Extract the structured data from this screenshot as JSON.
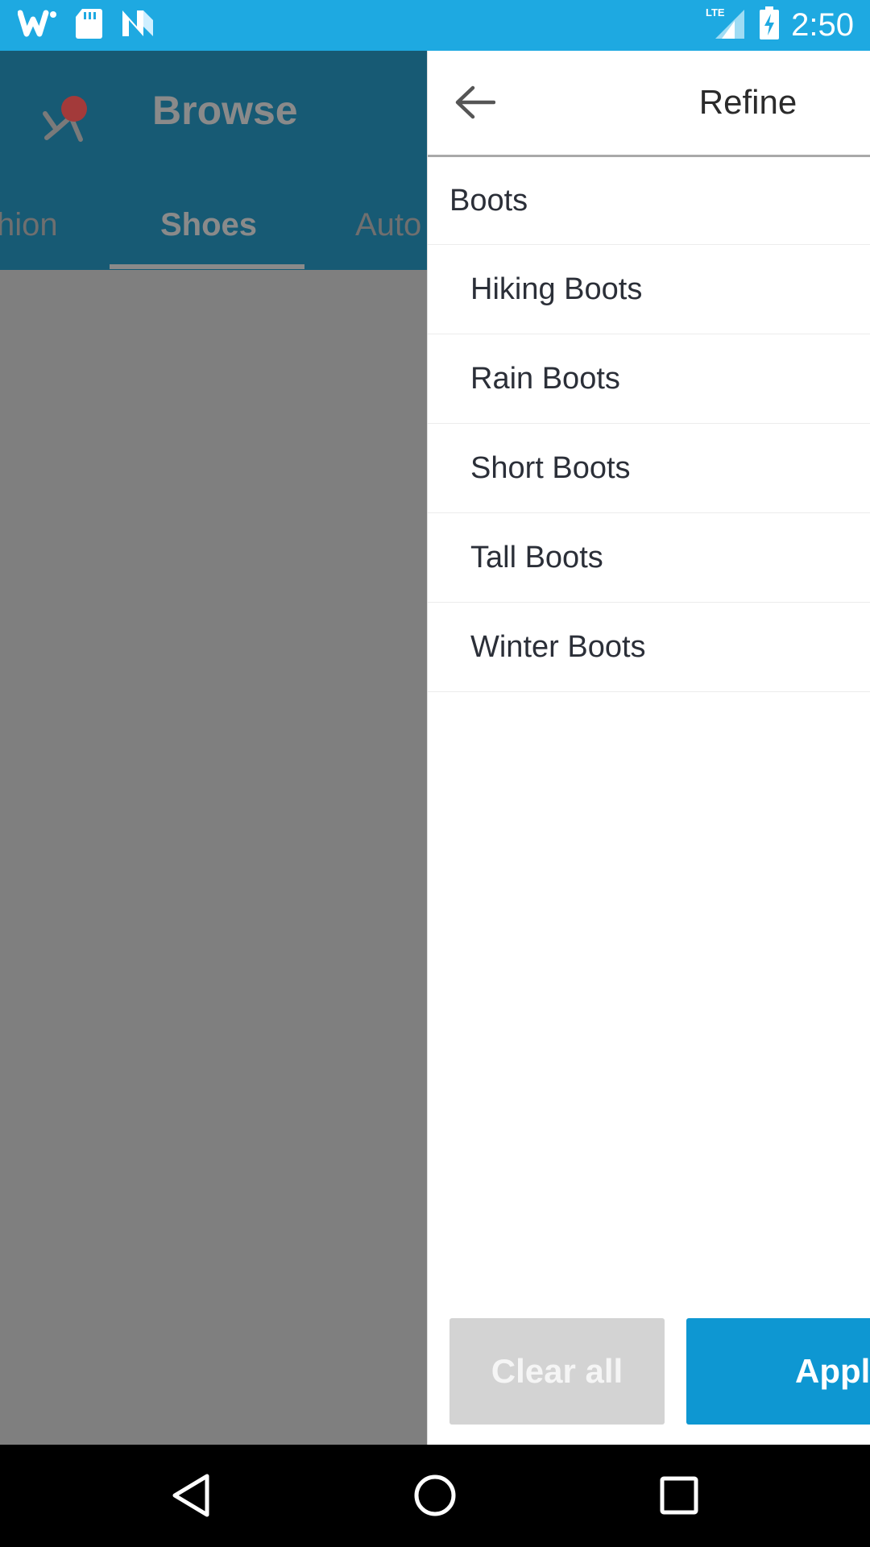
{
  "status_bar": {
    "left_icons": [
      "wish-app-icon",
      "sd-card-icon",
      "n-notification-icon"
    ],
    "network": "LTE",
    "time": "2:50"
  },
  "background": {
    "title": "Browse",
    "tabs": [
      "hion",
      "Shoes",
      "Auto"
    ],
    "active_tab": "Shoes"
  },
  "drawer": {
    "title": "Refine",
    "parent_category": "Boots",
    "items": [
      "Hiking Boots",
      "Rain Boots",
      "Short Boots",
      "Tall Boots",
      "Winter Boots"
    ],
    "clear_label": "Clear all",
    "apply_label": "Appl"
  },
  "colors": {
    "status_bar": "#1ea9e1",
    "apply_button": "#0e97d2",
    "clear_button": "#d3d3d3"
  }
}
